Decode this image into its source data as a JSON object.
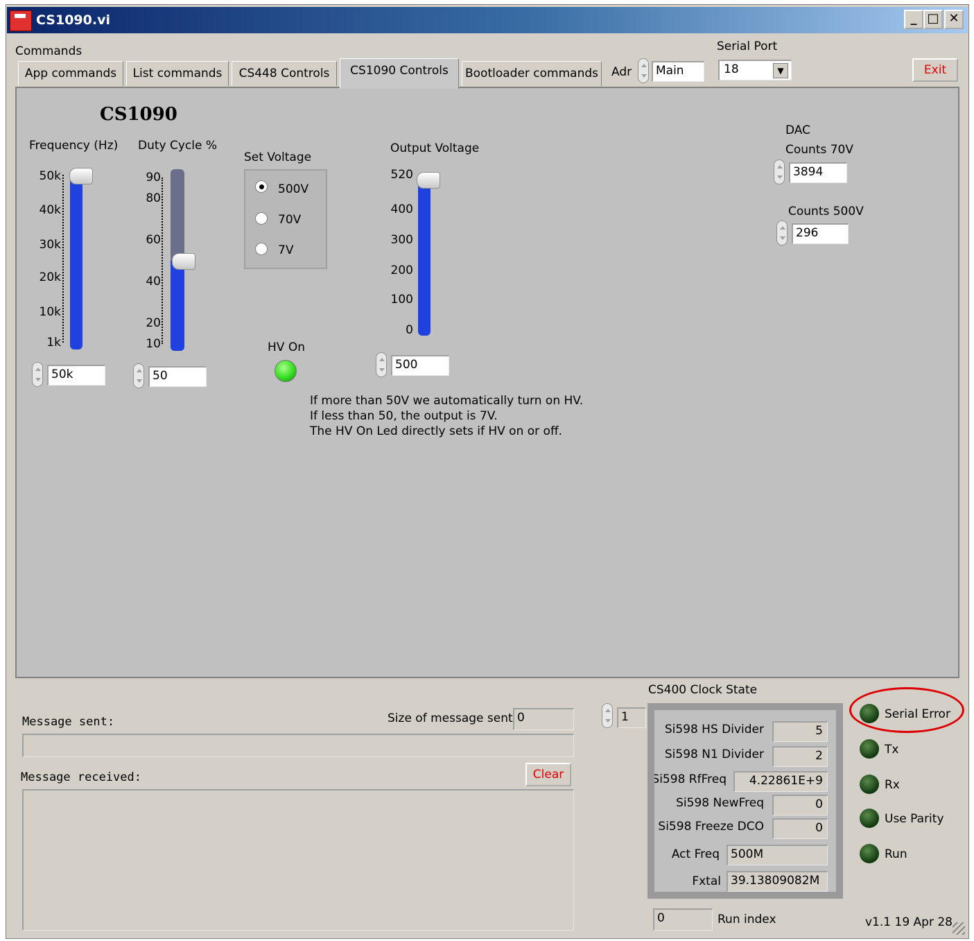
{
  "window": {
    "title": "CS1090.vi"
  },
  "header": {
    "commands_label": "Commands",
    "serial_port_label": "Serial Port",
    "serial_port_value": "18",
    "adr_label": "Adr",
    "adr_value": "Main",
    "exit_label": "Exit"
  },
  "tabs": [
    {
      "label": "App commands"
    },
    {
      "label": "List commands"
    },
    {
      "label": "CS448 Controls"
    },
    {
      "label": "CS1090 Controls"
    },
    {
      "label": "Bootloader commands"
    }
  ],
  "panel": {
    "heading": "CS1090",
    "frequency": {
      "label": "Frequency (Hz)",
      "ticks": [
        "50k",
        "40k",
        "30k",
        "20k",
        "10k",
        "1k"
      ],
      "value": "50k"
    },
    "duty": {
      "label": "Duty Cycle %",
      "ticks": [
        "90",
        "80",
        "60",
        "40",
        "20",
        "10"
      ],
      "value": "50"
    },
    "set_voltage": {
      "label": "Set Voltage",
      "options": [
        "500V",
        "70V",
        "7V"
      ],
      "selected": "500V"
    },
    "output": {
      "label": "Output Voltage",
      "ticks": [
        "520",
        "400",
        "300",
        "200",
        "100",
        "0"
      ],
      "value": "500"
    },
    "hv_on_label": "HV On",
    "note_lines": [
      "If more than 50V we automatically turn on HV.",
      "If less than 50, the output is 7V.",
      "The HV On Led directly sets if HV on or off."
    ],
    "dac_label": "DAC",
    "counts70_label": "Counts 70V",
    "counts70_value": "3894",
    "counts500_label": "Counts 500V",
    "counts500_value": "296"
  },
  "messages": {
    "sent_label": "Message sent:",
    "size_label": "Size of message sent",
    "size_value": "0",
    "received_label": "Message received:",
    "clear_label": "Clear"
  },
  "clock": {
    "title": "CS400 Clock State",
    "index_value": "1",
    "rows": [
      {
        "label": "Si598 HS Divider",
        "value": "5"
      },
      {
        "label": "Si598 N1 Divider",
        "value": "2"
      },
      {
        "label": "Si598 RfFreq",
        "value": "4.22861E+9"
      },
      {
        "label": "Si598 NewFreq",
        "value": "0"
      },
      {
        "label": "Si598 Freeze DCO",
        "value": "0"
      },
      {
        "label": "Act Freq",
        "value": "500M"
      },
      {
        "label": "Fxtal",
        "value": "39.13809082M"
      }
    ],
    "run_index_value": "0",
    "run_index_label": "Run index"
  },
  "indicators": [
    "Serial Error",
    "Tx",
    "Rx",
    "Use Parity",
    "Run"
  ],
  "version": "v1.1 19 Apr 28",
  "colors": {
    "accent_red": "#e00000",
    "led_on": "#33dd22",
    "slider_blue": "#2040e0"
  }
}
